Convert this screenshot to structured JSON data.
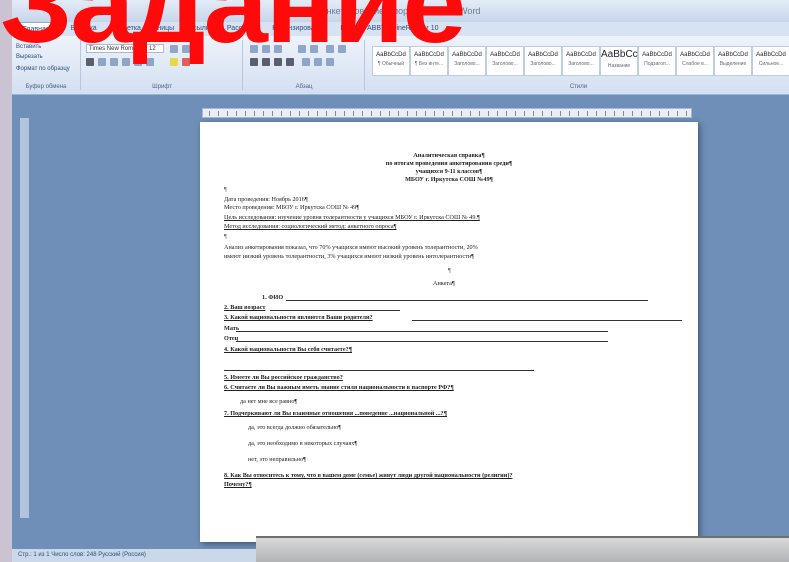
{
  "headline": "Задание",
  "app": {
    "window_title": "Анкетирование Спорт - Microsoft Word"
  },
  "ribbon": {
    "tabs": [
      "Главная",
      "Вставка",
      "Разметка страницы",
      "Ссылки",
      "Рассылки",
      "Рецензирование",
      "Вид",
      "ABBYY FineReader 10"
    ],
    "clipboard": {
      "paste": "Вставить",
      "cut": "Вырезать",
      "format_painter": "Формат по образцу",
      "label": "Буфер обмена"
    },
    "font": {
      "name": "Times New Roman",
      "size": "12",
      "label": "Шрифт"
    },
    "paragraph_label": "Абзац",
    "styles_label": "Стили",
    "styles": [
      {
        "preview": "AaBbCcDd",
        "name": "¶ Обычный"
      },
      {
        "preview": "AaBbCcDd",
        "name": "¶ Без инте..."
      },
      {
        "preview": "AaBbCcDd",
        "name": "Заголово..."
      },
      {
        "preview": "AaBbCcDd",
        "name": "Заголово..."
      },
      {
        "preview": "AaBbCcDd",
        "name": "Заголово..."
      },
      {
        "preview": "AaBbCcDd",
        "name": "Заголово..."
      },
      {
        "preview": "AaBbCc",
        "name": "Название"
      },
      {
        "preview": "AaBbCcDd",
        "name": "Подзагол..."
      },
      {
        "preview": "AaBbCcDd",
        "name": "Слабое в..."
      },
      {
        "preview": "AaBbCcDd",
        "name": "Выделение"
      },
      {
        "preview": "AaBbCcDd",
        "name": "Сильное..."
      }
    ]
  },
  "document": {
    "title_lines": [
      "Аналитическая справка¶",
      "по итогам проведения анкетирования среди¶",
      "учащихся 9-11 классов¶",
      "МБОУ г. Иркутска СОШ №49¶"
    ],
    "info": [
      "Дата проведения: Ноябрь 2016¶",
      "Место проведения: МБОУ г. Иркутска СОШ № 49¶",
      "Цель исследования: изучение уровня толерантности у учащихся МБОУ г. Иркутска СОШ № 49.¶",
      "Метод исследования: социологический метод: анкетного опроса¶"
    ],
    "analysis": [
      "Анализ анкетирования показал, что 70% учащихся имеют высокий уровень толерантности, 20%",
      "имеют низкий уровень толерантности, 3% учащихся имеют низкий уровень интолерантности¶"
    ],
    "anketa": "Анкета¶",
    "questions": [
      "1. ФИО",
      "2. Ваш возраст",
      "3. Какой национальности являются Ваши родители?",
      "Мать",
      "Отец",
      "4. Какой национальности Вы себя считаете?¶",
      "5. Имеете ли Вы российское гражданство?",
      "6. Считаете ли Вы важным иметь знание стиля национальности в паспорте РФ?¶",
      "да             нет            мне все равно¶",
      "7. Подчеркивают ли Вы взаимные отношения ...поведение ...национальной ...?¶",
      "да, это всегда должно обязательно¶",
      "да, это необходимо в некоторых случаях¶",
      "нет, это неправильно¶",
      "8. Как Вы относитесь к тому, что в вашем доме (семье) живут люди другой национальности (религии)?",
      "Почему?¶"
    ]
  },
  "statusbar": {
    "text": "Стр.: 1 из 1   Число слов: 248   Русский (Россия)"
  }
}
